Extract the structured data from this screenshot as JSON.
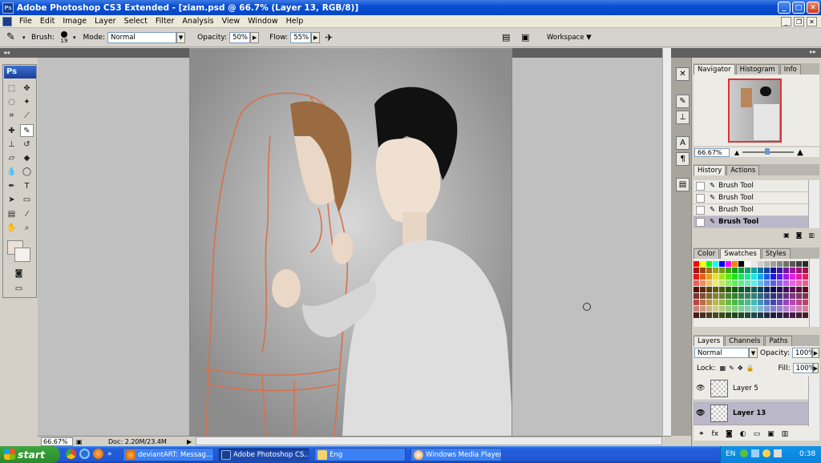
{
  "titlebar": {
    "title": "Adobe Photoshop CS3 Extended - [ziam.psd @ 66.7% (Layer 13, RGB/8)]",
    "min": "_",
    "max": "□",
    "close": "✕"
  },
  "menubar": {
    "items": [
      "File",
      "Edit",
      "Image",
      "Layer",
      "Select",
      "Filter",
      "Analysis",
      "View",
      "Window",
      "Help"
    ]
  },
  "options": {
    "brush_label": "Brush:",
    "brush_size": "19",
    "mode_label": "Mode:",
    "mode_value": "Normal",
    "opacity_label": "Opacity:",
    "opacity_value": "50%",
    "flow_label": "Flow:",
    "flow_value": "55%",
    "workspace_label": "Workspace ▼"
  },
  "toolbox": {
    "logo": "Ps"
  },
  "status": {
    "zoom": "66.67%",
    "doc": "Doc: 2.20M/23.4M"
  },
  "navigator": {
    "tabs": [
      "Navigator",
      "Histogram",
      "Info"
    ],
    "zoom": "66.67%"
  },
  "history": {
    "tabs": [
      "History",
      "Actions"
    ],
    "items": [
      "Brush Tool",
      "Brush Tool",
      "Brush Tool",
      "Brush Tool"
    ]
  },
  "color": {
    "tabs": [
      "Color",
      "Swatches",
      "Styles"
    ]
  },
  "layers": {
    "tabs": [
      "Layers",
      "Channels",
      "Paths"
    ],
    "blend_mode": "Normal",
    "opacity_label": "Opacity:",
    "opacity_value": "100%",
    "lock_label": "Lock:",
    "fill_label": "Fill:",
    "fill_value": "100%",
    "items": [
      {
        "name": "Layer 5"
      },
      {
        "name": "Layer 13"
      }
    ]
  },
  "taskbar": {
    "start": "start",
    "buttons": [
      "deviantART: Messag...",
      "Adobe Photoshop CS...",
      "Eng",
      "Windows Media Player"
    ],
    "lang": "EN",
    "clock": "0:38"
  },
  "colors": {
    "accent": "#0a4fd1",
    "swatch_bg": "#e9e0d6",
    "sketch": "#d9714a"
  }
}
